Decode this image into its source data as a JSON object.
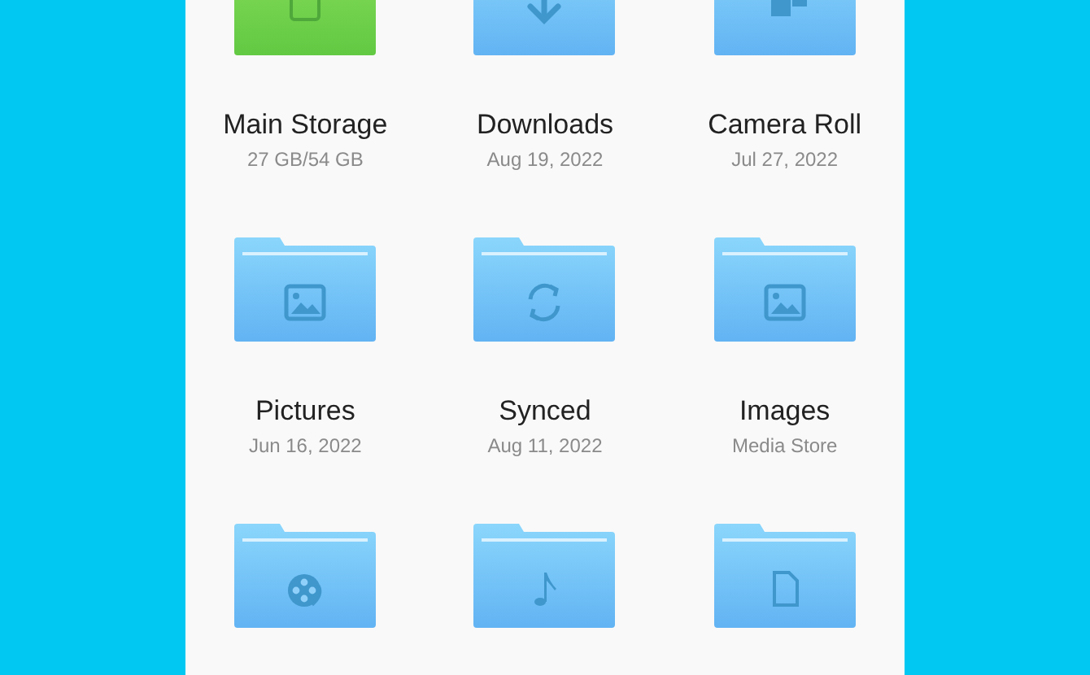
{
  "items": [
    {
      "kind": "phone",
      "name": "Main Storage",
      "detail": "27 GB/54 GB"
    },
    {
      "kind": "download",
      "name": "Downloads",
      "detail": "Aug 19, 2022"
    },
    {
      "kind": "camera",
      "name": "Camera Roll",
      "detail": "Jul 27, 2022"
    },
    {
      "kind": "image",
      "name": "Pictures",
      "detail": "Jun 16, 2022"
    },
    {
      "kind": "sync",
      "name": "Synced",
      "detail": "Aug 11, 2022"
    },
    {
      "kind": "image",
      "name": "Images",
      "detail": "Media Store"
    },
    {
      "kind": "film"
    },
    {
      "kind": "music"
    },
    {
      "kind": "file"
    }
  ]
}
